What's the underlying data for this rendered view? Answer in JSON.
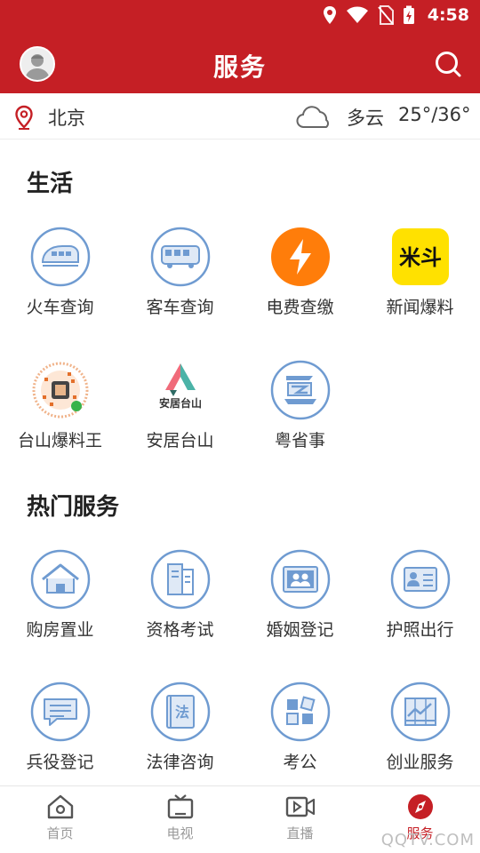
{
  "status": {
    "time": "4:58"
  },
  "header": {
    "title": "服务"
  },
  "location": {
    "city": "北京",
    "weather": "多云",
    "temperature": "25°/36°"
  },
  "sections": {
    "life": {
      "title": "生活",
      "items": [
        {
          "label": "火车查询",
          "icon": "train-icon"
        },
        {
          "label": "客车查询",
          "icon": "bus-icon"
        },
        {
          "label": "电费查缴",
          "icon": "lightning-icon"
        },
        {
          "label": "新闻爆料",
          "icon": "news-tip-icon"
        },
        {
          "label": "台山爆料王",
          "icon": "qr-code-icon"
        },
        {
          "label": "安居台山",
          "icon": "anju-logo-icon"
        },
        {
          "label": "粤省事",
          "icon": "yueshengshi-icon"
        }
      ],
      "anju_logo_text": "安居台山"
    },
    "hot": {
      "title": "热门服务",
      "items": [
        {
          "label": "购房置业",
          "icon": "house-icon"
        },
        {
          "label": "资格考试",
          "icon": "exam-book-icon"
        },
        {
          "label": "婚姻登记",
          "icon": "marriage-certificate-icon"
        },
        {
          "label": "护照出行",
          "icon": "passport-icon"
        },
        {
          "label": "兵役登记",
          "icon": "message-icon"
        },
        {
          "label": "法律咨询",
          "icon": "law-book-icon"
        },
        {
          "label": "考公",
          "icon": "grid-apps-icon"
        },
        {
          "label": "创业服务",
          "icon": "chart-growth-icon"
        }
      ],
      "law_icon_text": "法"
    }
  },
  "news_icon_text": "米斗",
  "bottom_nav": [
    {
      "label": "首页",
      "icon": "home-icon",
      "active": false
    },
    {
      "label": "电视",
      "icon": "tv-icon",
      "active": false
    },
    {
      "label": "直播",
      "icon": "live-video-icon",
      "active": false
    },
    {
      "label": "服务",
      "icon": "compass-icon",
      "active": true
    }
  ],
  "watermark": "QQTV.COM",
  "colors": {
    "brand_red": "#c51f25",
    "icon_blue": "#6f9bd1",
    "icon_fill": "#dfe9f6",
    "orange": "#ff7d0a",
    "yellow": "#ffe100"
  }
}
